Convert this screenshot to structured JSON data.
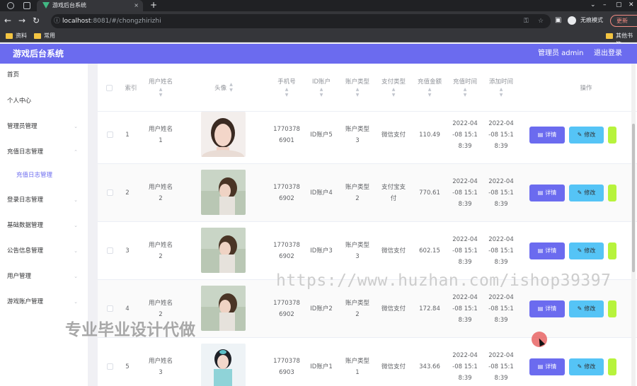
{
  "browser": {
    "tab_title": "游戏后台系统",
    "url_host": "localhost",
    "url_rest": ":8081/#/chongzhirizhi",
    "incognito_label": "无痕模式",
    "update_label": "更新",
    "bookmarks": [
      "资料",
      "常用"
    ],
    "other_bookmarks": "其他书签"
  },
  "header": {
    "brand": "游戏后台系统",
    "admin_label": "管理员 admin",
    "logout_label": "退出登录",
    "accent_color": "#6b6bef"
  },
  "sidebar": {
    "items": [
      {
        "label": "首页"
      },
      {
        "label": "个人中心"
      },
      {
        "label": "管理员管理"
      },
      {
        "label": "充值日志管理"
      },
      {
        "label": "充值日志管理"
      },
      {
        "label": "登录日志管理"
      },
      {
        "label": "基础数据管理"
      },
      {
        "label": "公告信息管理"
      },
      {
        "label": "用户管理"
      },
      {
        "label": "游戏账户管理"
      }
    ]
  },
  "table": {
    "headers": {
      "index": "索引",
      "username": "用户姓名",
      "avatar": "头像",
      "phone": "手机号",
      "account_id": "ID账户",
      "account_type": "账户类型",
      "pay_type": "支付类型",
      "amount": "充值金额",
      "recharge_time": "充值时间",
      "add_time": "添加时间",
      "actions": "操作"
    },
    "detail_label": "详情",
    "edit_label": "修改",
    "rows": [
      {
        "index": "1",
        "name_1": "用户姓名",
        "name_2": "1",
        "phone_1": "1770378",
        "phone_2": "6901",
        "account_id": "ID账户5",
        "type_1": "账户类型",
        "type_2": "3",
        "pay_1": "微信支付",
        "pay_2": "",
        "amount": "110.49",
        "rt_1": "2022-04",
        "rt_2": "-08 15:1",
        "rt_3": "8:39",
        "at_1": "2022-04",
        "at_2": "-08 15:1",
        "at_3": "8:39"
      },
      {
        "index": "2",
        "name_1": "用户姓名",
        "name_2": "2",
        "phone_1": "1770378",
        "phone_2": "6902",
        "account_id": "ID账户4",
        "type_1": "账户类型",
        "type_2": "2",
        "pay_1": "支付宝支",
        "pay_2": "付",
        "amount": "770.61",
        "rt_1": "2022-04",
        "rt_2": "-08 15:1",
        "rt_3": "8:39",
        "at_1": "2022-04",
        "at_2": "-08 15:1",
        "at_3": "8:39"
      },
      {
        "index": "3",
        "name_1": "用户姓名",
        "name_2": "2",
        "phone_1": "1770378",
        "phone_2": "6902",
        "account_id": "ID账户3",
        "type_1": "账户类型",
        "type_2": "3",
        "pay_1": "微信支付",
        "pay_2": "",
        "amount": "602.15",
        "rt_1": "2022-04",
        "rt_2": "-08 15:1",
        "rt_3": "8:39",
        "at_1": "2022-04",
        "at_2": "-08 15:1",
        "at_3": "8:39"
      },
      {
        "index": "4",
        "name_1": "用户姓名",
        "name_2": "2",
        "phone_1": "1770378",
        "phone_2": "6902",
        "account_id": "ID账户2",
        "type_1": "账户类型",
        "type_2": "2",
        "pay_1": "微信支付",
        "pay_2": "",
        "amount": "172.84",
        "rt_1": "2022-04",
        "rt_2": "-08 15:1",
        "rt_3": "8:39",
        "at_1": "2022-04",
        "at_2": "-08 15:1",
        "at_3": "8:39"
      },
      {
        "index": "5",
        "name_1": "用户姓名",
        "name_2": "3",
        "phone_1": "1770378",
        "phone_2": "6903",
        "account_id": "ID账户1",
        "type_1": "账户类型",
        "type_2": "1",
        "pay_1": "微信支付",
        "pay_2": "",
        "amount": "343.66",
        "rt_1": "2022-04",
        "rt_2": "-08 15:1",
        "rt_3": "8:39",
        "at_1": "2022-04",
        "at_2": "-08 15:1",
        "at_3": "8:39"
      }
    ]
  },
  "watermarks": {
    "url": "https://www.huzhan.com/ishop39397",
    "text": "专业毕业设计代做"
  }
}
